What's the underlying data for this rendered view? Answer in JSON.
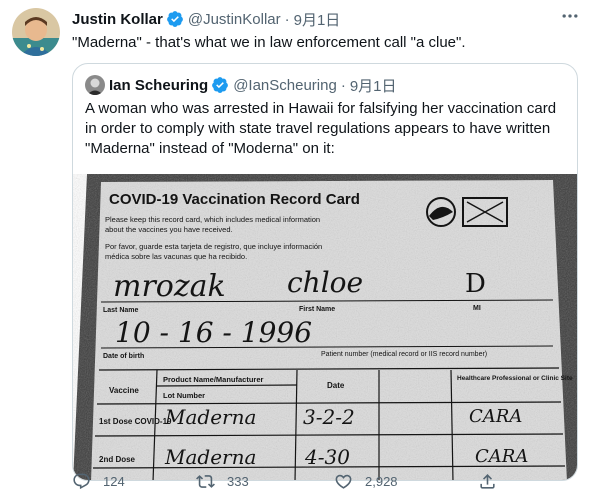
{
  "tweet": {
    "author_name": "Justin Kollar",
    "author_handle": "@JustinKollar",
    "separator": "·",
    "time": "9月1日",
    "text": "\"Maderna\" - that's what we in law enforcement call \"a clue\"."
  },
  "quoted": {
    "author_name": "Ian Scheuring",
    "author_handle": "@IanScheuring",
    "separator": "·",
    "time": "9月1日",
    "text": "A woman who was arrested in Hawaii for falsifying her vaccination card in order to comply with state travel regulations appears to have written \"Maderna\" instead of \"Moderna\" on it:"
  },
  "card": {
    "title": "COVID-19 Vaccination Record Card",
    "instructions_en_1": "Please keep this record card, which includes medical information",
    "instructions_en_2": "about the vaccines you have received.",
    "instructions_es_1": "Por favor, guarde esta tarjeta de registro, que incluye información",
    "instructions_es_2": "médica sobre las vacunas que ha recibido.",
    "handwritten_last_name": "mrozak",
    "handwritten_first_name": "chloe",
    "handwritten_initial": "D",
    "label_last_name": "Last Name",
    "label_first_name": "First Name",
    "label_mi": "MI",
    "handwritten_dob": "10 - 16 - 1996",
    "label_dob": "Date of birth",
    "label_patient_number": "Patient number (medical record or IIS record number)",
    "col_vaccine": "Vaccine",
    "col_product": "Product Name/Manufacturer",
    "col_lot": "Lot Number",
    "col_date": "Date",
    "col_site": "Healthcare Professional or Clinic Site",
    "row_1": "1st Dose COVID-19",
    "row_2": "2nd Dose",
    "handwritten_product_1": "Maderna",
    "handwritten_date_1": "3-2-2",
    "handwritten_site_1": "CARA",
    "handwritten_product_2": "Maderna",
    "handwritten_date_2": "4-30",
    "handwritten_site_2": "CARA"
  },
  "actions": {
    "reply_count": "124",
    "retweet_count": "333",
    "like_count": "2,928"
  },
  "colors": {
    "text": "#0f1419",
    "secondary": "#536471",
    "verified": "#1d9bf0",
    "border": "#cfd9de"
  },
  "icons": [
    "more-icon",
    "verified-icon",
    "reply-icon",
    "retweet-icon",
    "like-icon",
    "share-icon"
  ]
}
